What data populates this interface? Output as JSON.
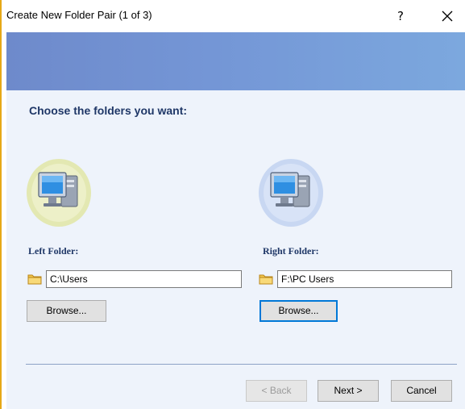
{
  "window": {
    "title": "Create New Folder Pair (1 of 3)",
    "help_label": "?",
    "colors": {
      "banner_start": "#6e8acb",
      "banner_end": "#7ca8de",
      "content_bg": "#eef3fb",
      "heading_text": "#1f3767",
      "focus_border": "#0078d7"
    }
  },
  "main": {
    "heading": "Choose the folders you want:"
  },
  "left": {
    "label": "Left Folder:",
    "path": "C:\\Users",
    "browse_label": "Browse...",
    "icon": "computer-icon"
  },
  "right": {
    "label": "Right Folder:",
    "path": "F:\\PC Users",
    "browse_label": "Browse...",
    "icon": "computer-icon"
  },
  "footer": {
    "back_label": "< Back",
    "next_label": "Next >",
    "cancel_label": "Cancel"
  }
}
